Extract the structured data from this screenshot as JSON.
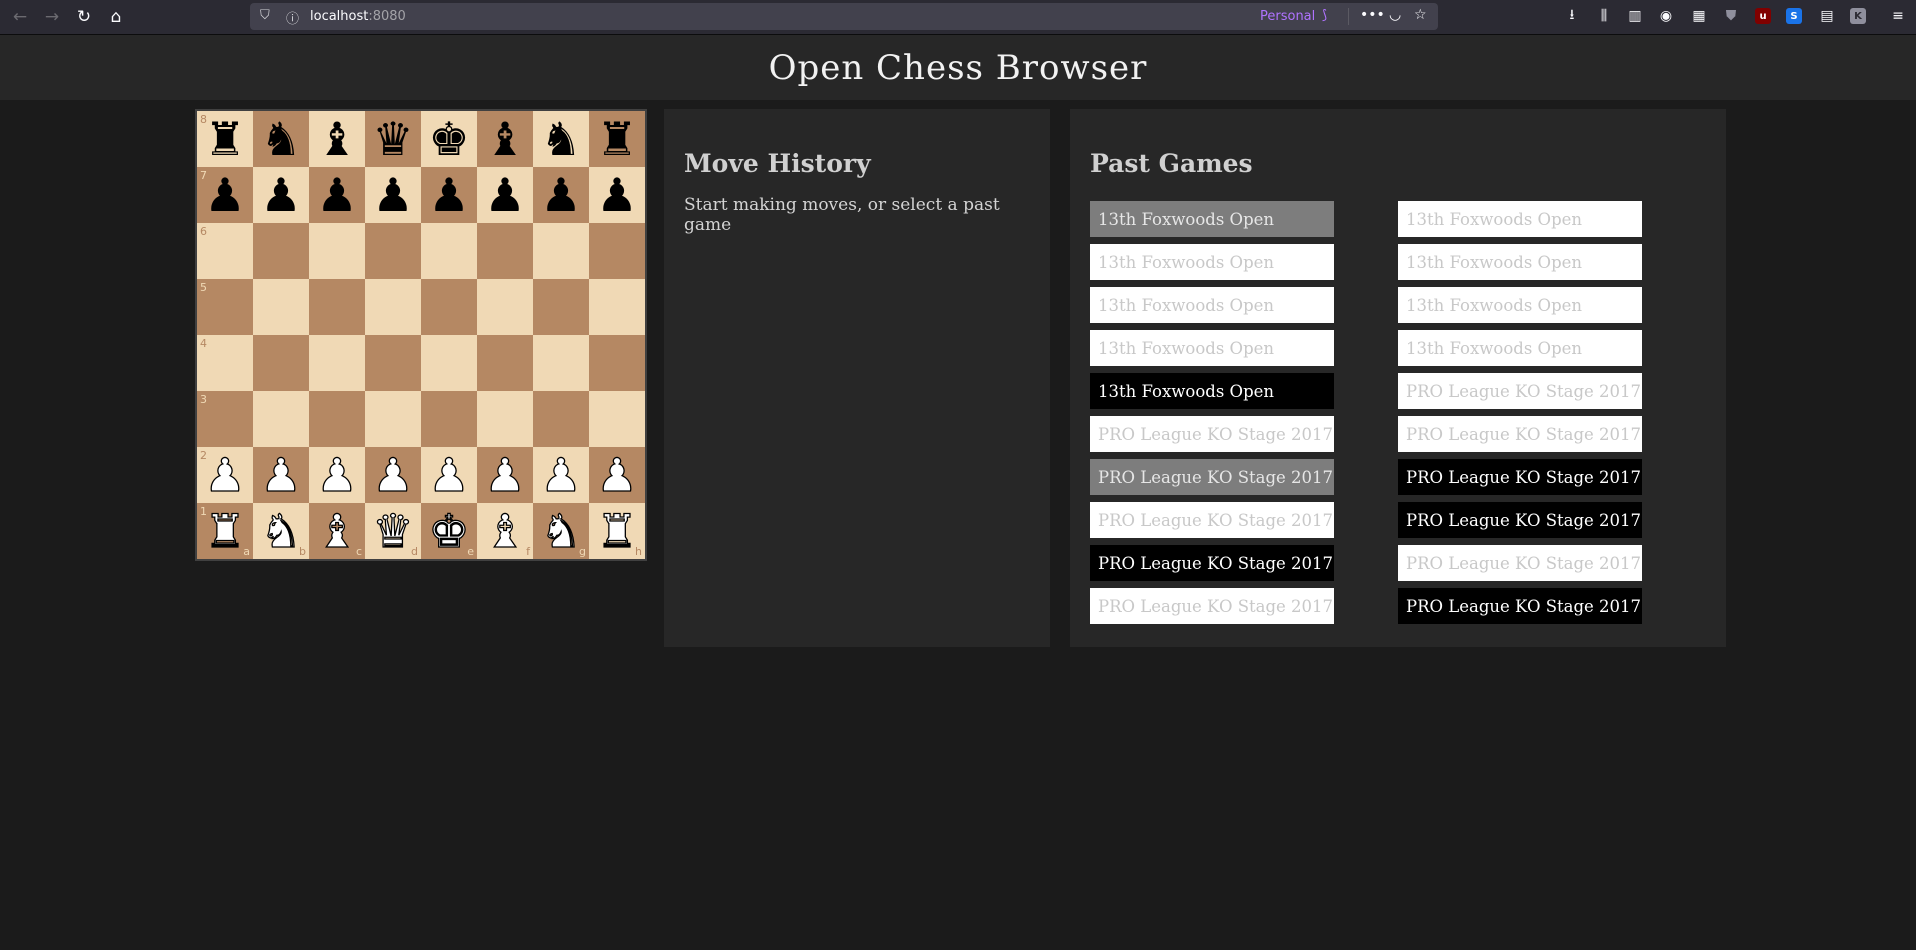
{
  "browser": {
    "url_host": "localhost",
    "url_port": ":8080",
    "container_label": "Personal"
  },
  "header": {
    "title": "Open Chess Browser"
  },
  "board": {
    "ranks": [
      "8",
      "7",
      "6",
      "5",
      "4",
      "3",
      "2",
      "1"
    ],
    "files": [
      "a",
      "b",
      "c",
      "d",
      "e",
      "f",
      "g",
      "h"
    ],
    "position": [
      [
        "bR",
        "bN",
        "bB",
        "bQ",
        "bK",
        "bB",
        "bN",
        "bR"
      ],
      [
        "bP",
        "bP",
        "bP",
        "bP",
        "bP",
        "bP",
        "bP",
        "bP"
      ],
      [
        "",
        "",
        "",
        "",
        "",
        "",
        "",
        ""
      ],
      [
        "",
        "",
        "",
        "",
        "",
        "",
        "",
        ""
      ],
      [
        "",
        "",
        "",
        "",
        "",
        "",
        "",
        ""
      ],
      [
        "",
        "",
        "",
        "",
        "",
        "",
        "",
        ""
      ],
      [
        "wP",
        "wP",
        "wP",
        "wP",
        "wP",
        "wP",
        "wP",
        "wP"
      ],
      [
        "wR",
        "wN",
        "wB",
        "wQ",
        "wK",
        "wB",
        "wN",
        "wR"
      ]
    ],
    "light_color": "#f0d9b5",
    "dark_color": "#b58863"
  },
  "move_history": {
    "title": "Move History",
    "hint": "Start making moves, or select a past game"
  },
  "past_games": {
    "title": "Past Games",
    "columns": [
      [
        {
          "label": "13th Foxwoods Open",
          "state": "hover"
        },
        {
          "label": "13th Foxwoods Open",
          "state": "normal"
        },
        {
          "label": "13th Foxwoods Open",
          "state": "normal"
        },
        {
          "label": "13th Foxwoods Open",
          "state": "normal"
        },
        {
          "label": "13th Foxwoods Open",
          "state": "active"
        },
        {
          "label": "PRO League KO Stage 2017",
          "state": "normal"
        },
        {
          "label": "PRO League KO Stage 2017",
          "state": "hover"
        },
        {
          "label": "PRO League KO Stage 2017",
          "state": "normal"
        },
        {
          "label": "PRO League KO Stage 2017",
          "state": "active"
        },
        {
          "label": "PRO League KO Stage 2017",
          "state": "normal"
        }
      ],
      [
        {
          "label": "13th Foxwoods Open",
          "state": "normal"
        },
        {
          "label": "13th Foxwoods Open",
          "state": "normal"
        },
        {
          "label": "13th Foxwoods Open",
          "state": "normal"
        },
        {
          "label": "13th Foxwoods Open",
          "state": "normal"
        },
        {
          "label": "PRO League KO Stage 2017",
          "state": "normal"
        },
        {
          "label": "PRO League KO Stage 2017",
          "state": "normal"
        },
        {
          "label": "PRO League KO Stage 2017",
          "state": "active"
        },
        {
          "label": "PRO League KO Stage 2017",
          "state": "active"
        },
        {
          "label": "PRO League KO Stage 2017",
          "state": "normal"
        },
        {
          "label": "PRO League KO Stage 2017",
          "state": "active"
        }
      ]
    ]
  }
}
